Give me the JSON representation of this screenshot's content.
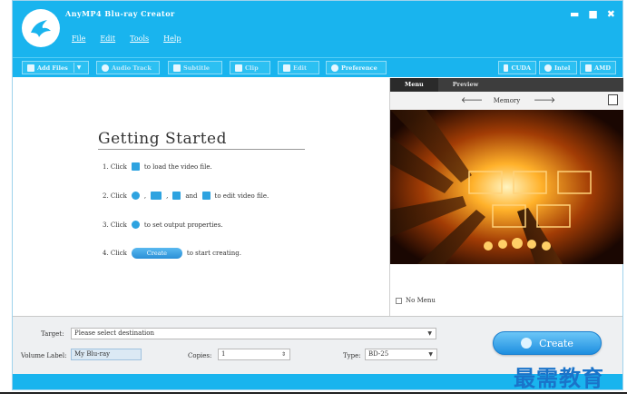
{
  "app": {
    "title": "AnyMP4 Blu-ray Creator",
    "window_controls": {
      "minimize": "▬",
      "maximize": "■",
      "close": "✖"
    }
  },
  "menu": [
    "File",
    "Edit",
    "Tools",
    "Help"
  ],
  "toolbar": {
    "add_files": "Add Files",
    "audio_track": "Audio Track",
    "subtitle": "Subtitle",
    "clip": "Clip",
    "edit": "Edit",
    "preference": "Preference",
    "cuda": "CUDA",
    "intel": "Intel",
    "amd": "AMD"
  },
  "getting_started": {
    "title": "Getting Started",
    "step1": {
      "num": "1. Click",
      "text": "to load the video file."
    },
    "step2": {
      "num": "2. Click",
      "comma1": ",",
      "comma2": ",",
      "and": "and",
      "text": "to edit video file."
    },
    "step3": {
      "num": "3. Click",
      "text": "to set output properties."
    },
    "step4": {
      "num": "4. Click",
      "button": "Create",
      "text": "to start creating."
    }
  },
  "menu_panel": {
    "tabs": [
      "Menu",
      "Preview"
    ],
    "template_name": "Memory",
    "prev_arrow": "🡐",
    "next_arrow": "🡒",
    "no_menu_label": "No Menu",
    "no_menu_checked": false
  },
  "bottom": {
    "target_label": "Target:",
    "target_value": "Please select destination",
    "volume_label": "Volume Label:",
    "volume_value": "My Blu-ray",
    "copies_label": "Copies:",
    "copies_value": "1",
    "type_label": "Type:",
    "type_value": "BD-25",
    "create_button": "Create"
  },
  "watermark": "最需教育",
  "colors": {
    "accent": "#19b4ee",
    "create_button": "#1e8fe0"
  }
}
